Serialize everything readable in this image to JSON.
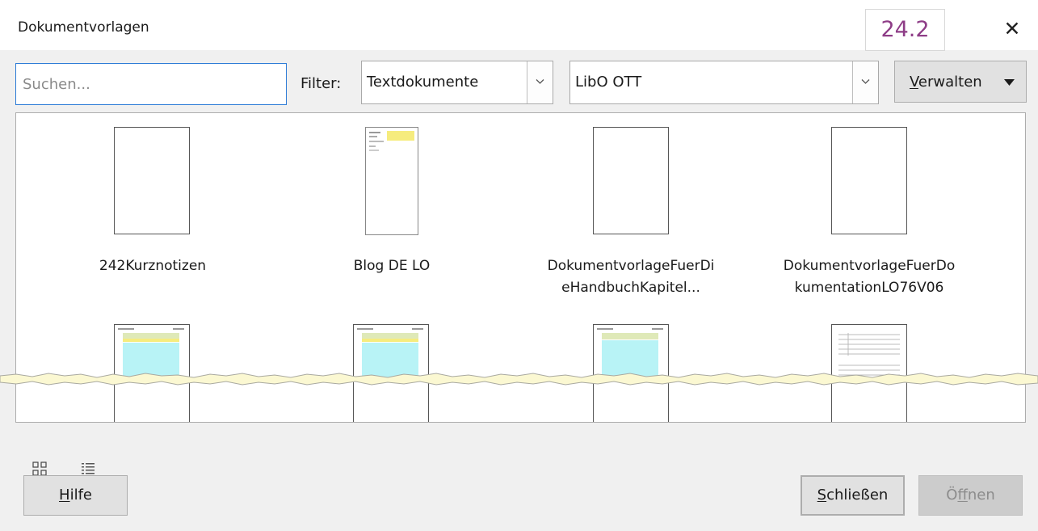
{
  "dialog": {
    "title": "Dokumentvorlagen",
    "version_badge": "24.2"
  },
  "search": {
    "placeholder": "Suchen..."
  },
  "filter": {
    "label": "Filter:",
    "type_selected": "Textdokumente",
    "category_selected": "LibO OTT"
  },
  "manage": {
    "label_mnemonic": "V",
    "label_rest": "erwalten"
  },
  "templates": [
    {
      "line1": "242Kurznotizen",
      "line2": ""
    },
    {
      "line1": "Blog DE LO",
      "line2": ""
    },
    {
      "line1": "DokumentvorlageFuerDi",
      "line2": "eHandbuchKapitel..."
    },
    {
      "line1": "DokumentvorlageFuerDo",
      "line2": "kumentationLO76V06"
    }
  ],
  "buttons": {
    "help_mnemonic": "H",
    "help_rest": "ilfe",
    "close_mnemonic": "S",
    "close_rest": "chließen",
    "open_pre": "Ö",
    "open_mnemonic": "f",
    "open_rest": "fnen"
  },
  "icons": {
    "close": "close-icon",
    "dropdown": "chevron-down-icon",
    "menu": "triangle-down-icon",
    "thumbnail_view": "grid-view-icon",
    "list_view": "list-view-icon"
  },
  "colors": {
    "badge_text": "#8e3d87",
    "focus_border": "#2c7bd6",
    "tear_fill": "#fbf8d2"
  }
}
